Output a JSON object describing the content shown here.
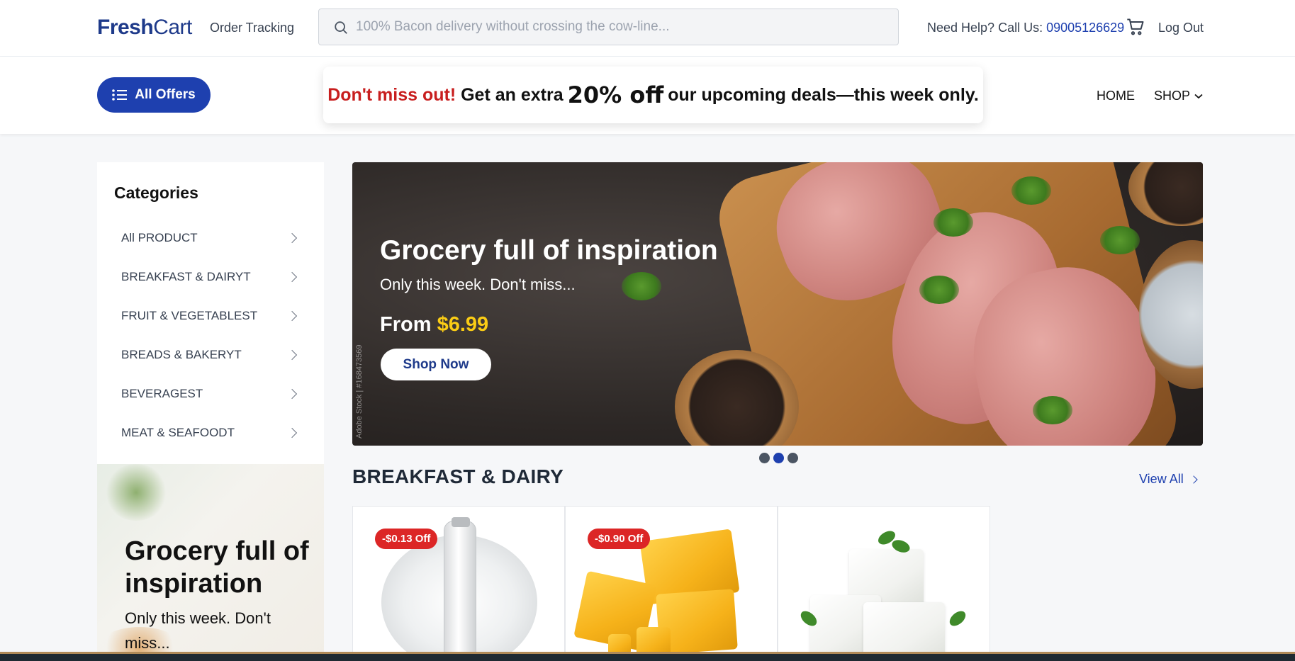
{
  "header": {
    "logo_bold": "Fresh",
    "logo_light": "Cart",
    "order_tracking": "Order Tracking",
    "search_placeholder": "100% Bacon delivery without crossing the cow-line...",
    "help_text": "Need Help? Call Us: ",
    "help_phone": "09005126629",
    "logout": "Log Out",
    "icons": [
      "search-icon",
      "cart-icon"
    ]
  },
  "nav": {
    "all_offers": "All Offers",
    "promo": {
      "highlight": "Don't miss out!",
      "part1": "Get an extra",
      "big": "20% off",
      "part2": "our upcoming deals—this week only."
    },
    "home": "HOME",
    "shop": "SHOP"
  },
  "categories": {
    "title": "Categories",
    "items": [
      "All PRODUCT",
      "BREAKFAST & DAIRYT",
      "FRUIT & VEGETABLEST",
      "BREADS & BAKERYT",
      "BEVERAGEST",
      "MEAT & SEAFOODT"
    ]
  },
  "side_promo": {
    "title": "Grocery full of inspiration",
    "subtitle": "Only this week. Don't miss..."
  },
  "hero": {
    "title": "Grocery full of inspiration",
    "subtitle": "Only this week. Don't miss...",
    "from_label": "From",
    "price": "$6.99",
    "button": "Shop Now",
    "watermark": "Adobe Stock | #168473569",
    "slides": 3,
    "active_slide": 2
  },
  "section": {
    "title": "BREAKFAST & DAIRY",
    "view_all": "View All"
  },
  "products": [
    {
      "badge": "-$0.13 Off",
      "image": "milk-bottle-splash"
    },
    {
      "badge": "-$0.90 Off",
      "image": "cheese-blocks"
    },
    {
      "badge": "",
      "image": "tofu-cubes"
    }
  ],
  "colors": {
    "brand": "#1e40af",
    "promo_red": "#c81e1e",
    "price_yellow": "#facc15",
    "badge_red": "#dc2626"
  }
}
